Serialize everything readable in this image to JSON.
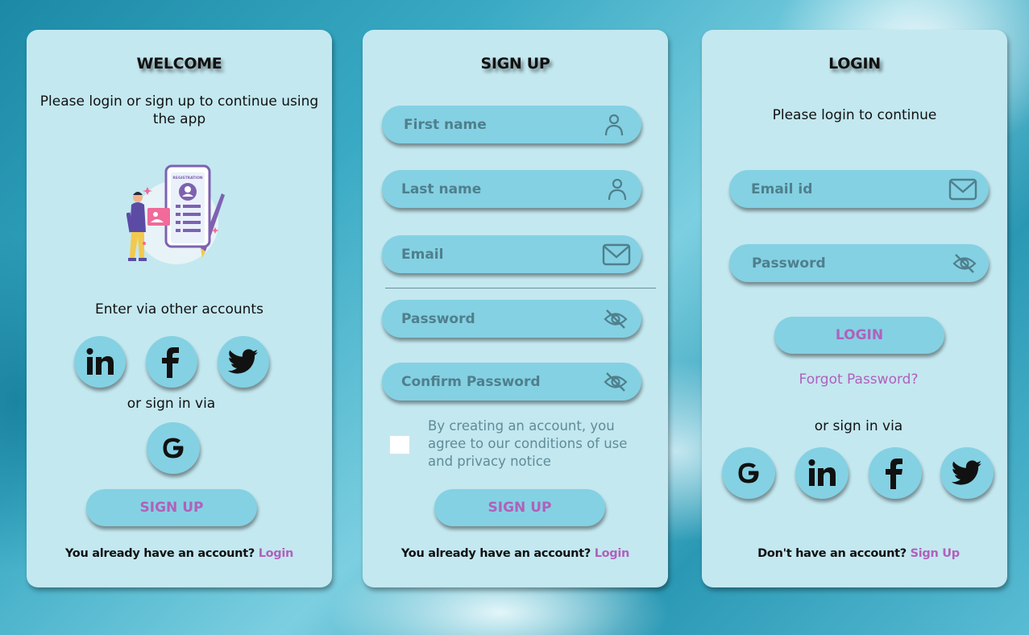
{
  "welcome": {
    "title": "WELCOME",
    "subtitle": "Please login or sign up to continue using the app",
    "illustration_text": "REGISTRATION",
    "other_accounts": "Enter via other accounts",
    "or_sign_in": "or sign in via",
    "signup_button": "SIGN UP",
    "bottom_text": "You already have an account?",
    "bottom_link": "Login"
  },
  "signup": {
    "title": "SIGN UP",
    "first_name": "First name",
    "last_name": "Last name",
    "email": "Email",
    "password": "Password",
    "confirm_password": "Confirm Password",
    "terms": "By creating an account, you agree to our conditions of use and privacy notice",
    "signup_button": "SIGN UP",
    "bottom_text": "You already have an account?",
    "bottom_link": "Login"
  },
  "login": {
    "title": "LOGIN",
    "subtitle": "Please login to continue",
    "email": "Email id",
    "password": "Password",
    "login_button": "LOGIN",
    "forgot": "Forgot Password?",
    "or_sign_in": "or sign in via",
    "bottom_text": "Don't have an account?",
    "bottom_link": "Sign Up"
  },
  "colors": {
    "card": "#c3e8f0",
    "input": "#84d1e3",
    "accent": "#b061bb",
    "placeholder": "#4f7f8c"
  },
  "icons": [
    "user-icon",
    "mail-icon",
    "eye-off-icon",
    "linkedin-icon",
    "facebook-icon",
    "twitter-icon",
    "google-icon"
  ]
}
